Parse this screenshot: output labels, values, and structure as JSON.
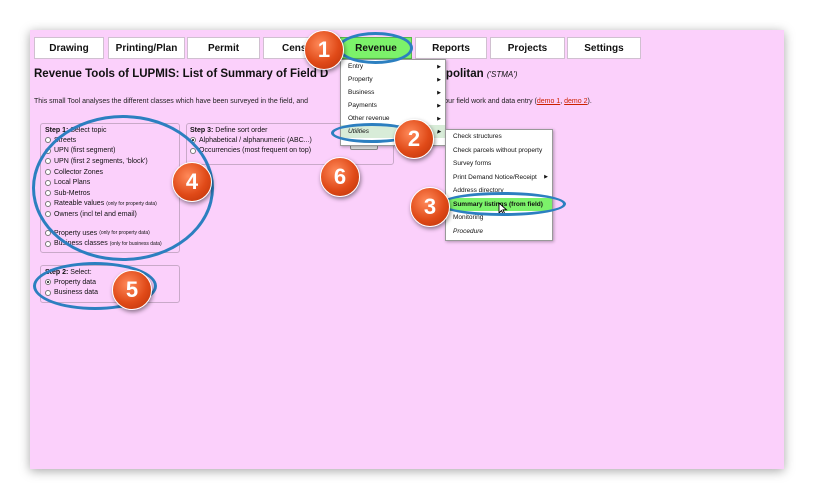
{
  "tabs": [
    {
      "label": "Drawing"
    },
    {
      "label": "Printing/Plan"
    },
    {
      "label": "Permit"
    },
    {
      "label": "Cens"
    },
    {
      "label": "Revenue"
    },
    {
      "label": "Reports"
    },
    {
      "label": "Projects"
    },
    {
      "label": "Settings"
    }
  ],
  "title": {
    "part1": "Revenue Tools of LUPMIS: List of Summary of Field D",
    "part2": "radi Metropolitan ",
    "abbr": "('STMA')"
  },
  "description": {
    "part1": "This small Tool analyses the different classes which have been surveyed in the field, and",
    "part2": "help quality-control your field work and data entry (",
    "demo1": "demo 1",
    "sep": ", ",
    "demo2": "demo 2",
    "end": ")."
  },
  "step1": {
    "label": "Step 1:",
    "text": "Select topic",
    "options": [
      {
        "label": "Streets"
      },
      {
        "label": "UPN (first segment)"
      },
      {
        "label": "UPN (first 2 segments, 'block')"
      },
      {
        "label": "Collector Zones"
      },
      {
        "label": "Local Plans"
      },
      {
        "label": "Sub-Metros"
      },
      {
        "label": "Rateable values",
        "note": "(only for property data)"
      },
      {
        "label": "Owners (incl tel and email)"
      },
      {
        "label": "Property uses",
        "note": "(only for property data)"
      },
      {
        "label": "Business classes",
        "note": "(only for business data)"
      }
    ]
  },
  "step2": {
    "label": "Step 2:",
    "text": "Select:",
    "options": [
      {
        "label": "Property data"
      },
      {
        "label": "Business data"
      }
    ]
  },
  "step3": {
    "label": "Step 3:",
    "text": "Define sort order",
    "options": [
      {
        "label": "Alphabetical / alphanumeric (ABC...)"
      },
      {
        "label": "Occurrencies (most frequent on top)"
      }
    ]
  },
  "revenue_menu": [
    {
      "label": "Entry"
    },
    {
      "label": "Property"
    },
    {
      "label": "Business"
    },
    {
      "label": "Payments"
    },
    {
      "label": "Other revenue"
    },
    {
      "label": "Utilities"
    }
  ],
  "utilities_menu": [
    {
      "label": "Check structures"
    },
    {
      "label": "Check parcels without property"
    },
    {
      "label": "Survey forms"
    },
    {
      "label": "Print Demand Notice/Receipt"
    },
    {
      "label": "Address directory"
    },
    {
      "label": "Summary listings (from field)"
    },
    {
      "label": "Monitoring"
    },
    {
      "label": "Procedure"
    }
  ],
  "badges": [
    "1",
    "2",
    "3",
    "4",
    "5",
    "6"
  ],
  "colors": {
    "page_bg": "#fbd0fb",
    "active_tab": "#7cf26a",
    "highlight_oval": "#2c7fc0",
    "badge": "#e04a18",
    "link": "#cc2200"
  }
}
